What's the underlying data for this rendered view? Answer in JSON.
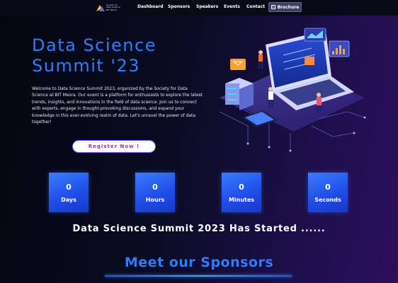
{
  "nav": {
    "logo_text": "Society for Data Science BIT Mesra",
    "links": [
      "Dashboard",
      "Sponsors",
      "Speakers",
      "Events",
      "Contact"
    ],
    "brochure_label": "Brochure"
  },
  "hero": {
    "title_line1": "Data Science",
    "title_line2": "Summit '23",
    "description": "Welcome to Data Science Summit 2023, organized by the Society for Data Science at BIT Mesra. Our event is a platform for enthusiasts to explore the latest trends, insights, and innovations in the field of data science. Join us to connect with experts, engage in thought-provoking discussions, and expand your knowledge in this ever-evolving realm of data. Let's unravel the power of data together!",
    "register_label": "Register Now !"
  },
  "countdown": [
    {
      "value": "0",
      "label": "Days"
    },
    {
      "value": "0",
      "label": "Hours"
    },
    {
      "value": "0",
      "label": "Minutes"
    },
    {
      "value": "0",
      "label": "Seconds"
    }
  ],
  "status_text": "Data Science Summit 2023 Has Started ......",
  "sponsors_heading": "Meet our Sponsors",
  "colors": {
    "accent": "#2f7dff",
    "register_text": "#c2208f",
    "nav_bg": "#080a18"
  }
}
